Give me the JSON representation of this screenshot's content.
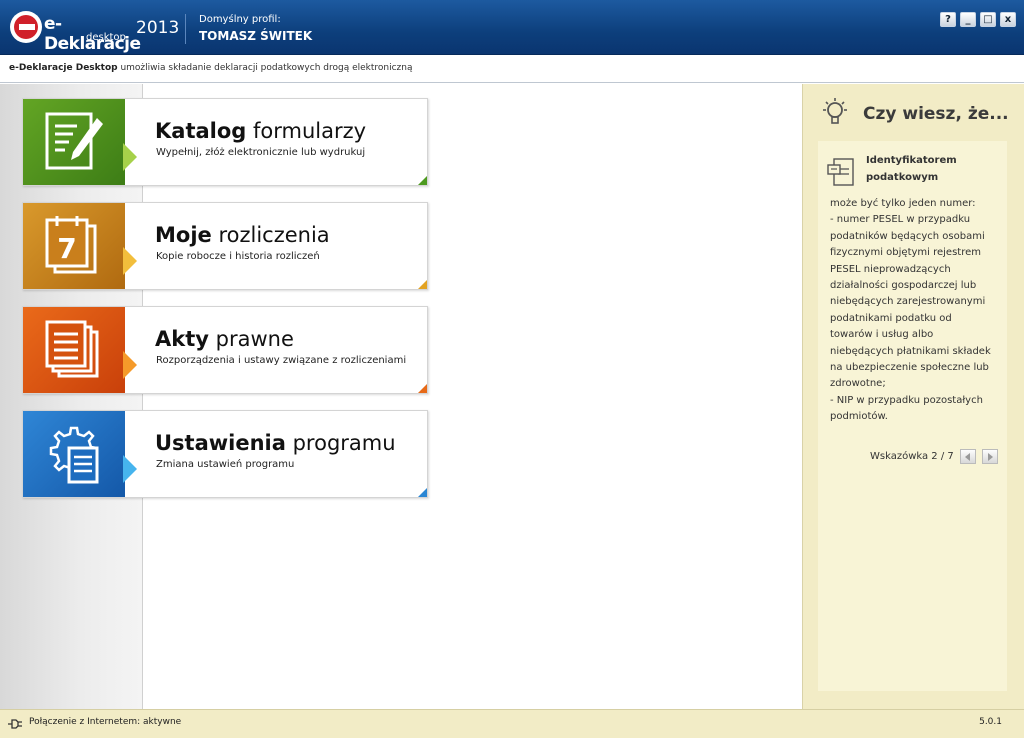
{
  "header": {
    "app_name": "e-Deklaracje",
    "app_sub": "desktop",
    "year": "2013",
    "profile_label": "Domyślny profil:",
    "profile_name": "TOMASZ ŚWITEK",
    "window_buttons": [
      "?",
      "_",
      "□",
      "x"
    ]
  },
  "subbar": {
    "bold": "e-Deklaracje Desktop",
    "text": " umożliwia składanie deklaracji podatkowych drogą elektroniczną"
  },
  "tiles": [
    {
      "title_bold": "Katalog",
      "title_rest": " formularzy",
      "desc": "Wypełnij, złóż elektronicznie lub wydrukuj",
      "icon": "form-pen-icon",
      "color": "#4d9a1f"
    },
    {
      "title_bold": "Moje",
      "title_rest": " rozliczenia",
      "desc": "Kopie robocze i historia rozliczeń",
      "icon": "calendar-icon",
      "color": "#e3a322"
    },
    {
      "title_bold": "Akty",
      "title_rest": " prawne",
      "desc": "Rozporządzenia i ustawy związane z rozliczeniami",
      "icon": "documents-icon",
      "color": "#e76a18"
    },
    {
      "title_bold": "Ustawienia",
      "title_rest": " programu",
      "desc": "Zmiana ustawień programu",
      "icon": "settings-gear-icon",
      "color": "#2a86d4"
    }
  ],
  "tip": {
    "heading": "Czy wiesz, że...",
    "title": "Identyfikatorem podatkowym",
    "body": [
      "może być tylko jeden numer:",
      "- numer PESEL w przypadku",
      "podatników będących osobami",
      "fizycznymi objętymi rejestrem",
      "PESEL nieprowadzących",
      "działalności gospodarczej lub",
      "niebędących zarejestrowanymi",
      "podatnikami podatku od",
      "towarów i usług albo",
      "niebędących płatnikami składek",
      "na ubezpieczenie społeczne lub",
      "zdrowotne;",
      "- NIP w przypadku pozostałych",
      "podmiotów."
    ],
    "nav_label": "Wskazówka 2 / 7"
  },
  "status": {
    "text": "Połączenie z Internetem: aktywne",
    "version": "5.0.1"
  }
}
